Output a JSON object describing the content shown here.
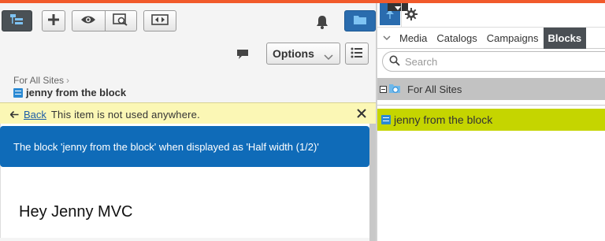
{
  "colors": {
    "accent": "#f15a2b",
    "banner": "#0f6bb8",
    "notice": "#fbf7b5",
    "selected": "#c5d500",
    "active_tab": "#4a4f54"
  },
  "toolbar": {
    "icons": [
      "tree-toggle-icon",
      "plus-icon",
      "eye-icon",
      "preview-icon",
      "compare-icon",
      "bell-icon",
      "folder-icon"
    ]
  },
  "options_row": {
    "options_label": "Options"
  },
  "breadcrumb": {
    "parent": "For All Sites",
    "separator": "›"
  },
  "item": {
    "title": "jenny from the block"
  },
  "notice": {
    "back_label": "Back",
    "message": "This item is not used anywhere."
  },
  "banner": {
    "text": "The block 'jenny from the block' when displayed as 'Half width (1/2)'"
  },
  "content": {
    "heading": "Hey Jenny MVC"
  },
  "assets_pane": {
    "tabs": [
      "Media",
      "Catalogs",
      "Campaigns",
      "Blocks"
    ],
    "active_tab": "Blocks",
    "search_placeholder": "Search",
    "tree_root": "For All Sites",
    "tree_item": "jenny from the block"
  }
}
